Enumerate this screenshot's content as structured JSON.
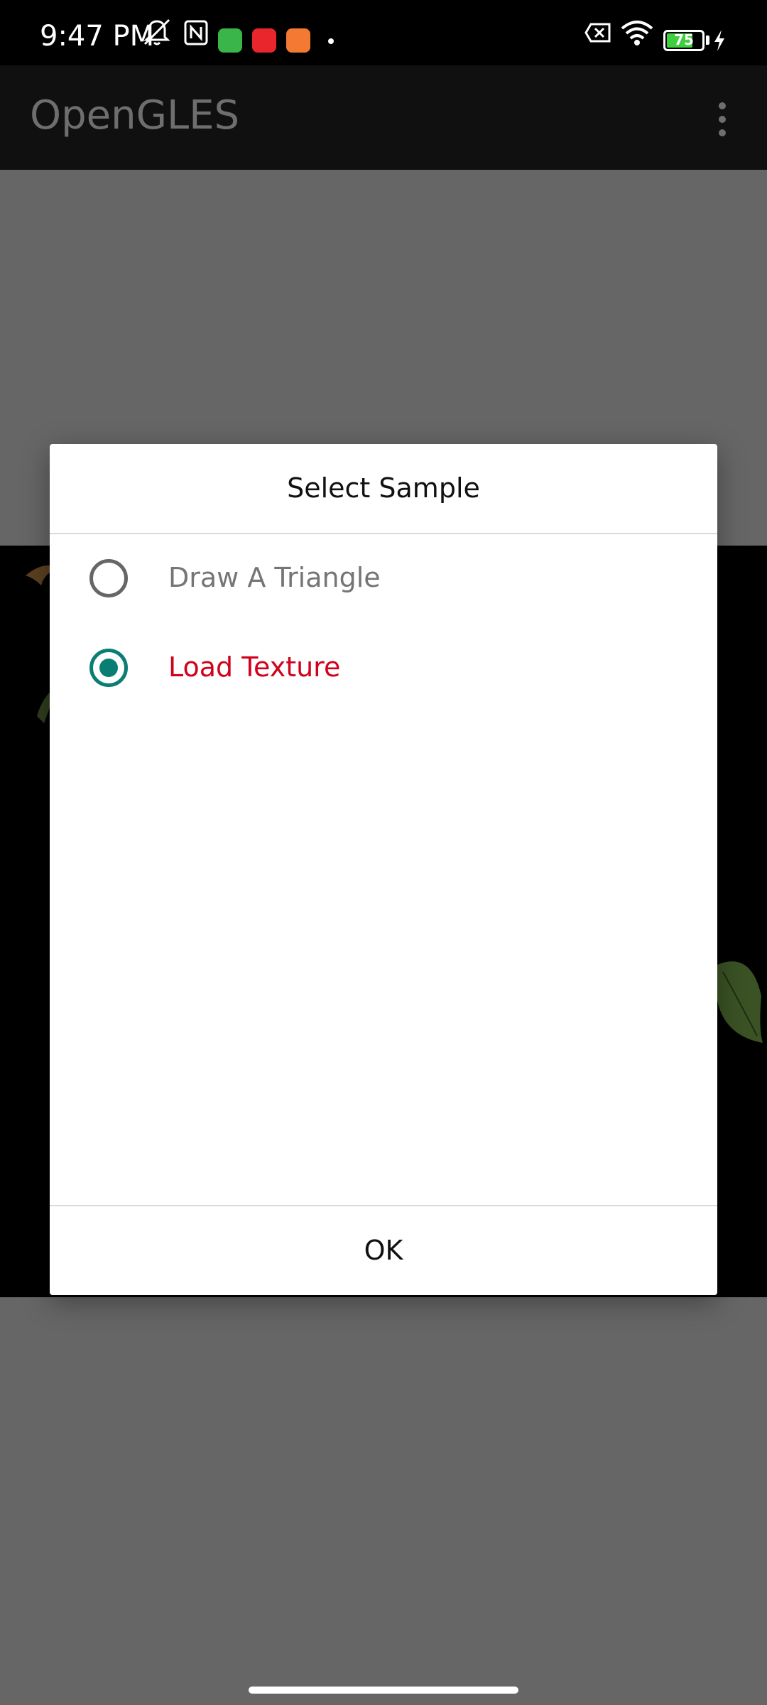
{
  "status_bar": {
    "time": "9:47 PM",
    "battery_level": "75",
    "battery_fraction": 0.75,
    "battery_color": "#3fcf3f",
    "icons": [
      "muted-bell-icon",
      "nfc-icon",
      "app-notification-icon",
      "app-notification-icon",
      "app-notification-icon",
      "no-sim-icon",
      "wifi-icon",
      "battery-icon",
      "charging-icon"
    ]
  },
  "app_bar": {
    "title": "OpenGLES",
    "menu_icon": "overflow-menu-icon"
  },
  "dialog": {
    "title": "Select Sample",
    "options": [
      {
        "label": "Draw A Triangle",
        "selected": false
      },
      {
        "label": "Load Texture",
        "selected": true
      }
    ],
    "ok_label": "OK",
    "accent_color": "#0a7e73",
    "selected_text_color": "#d0021b"
  }
}
